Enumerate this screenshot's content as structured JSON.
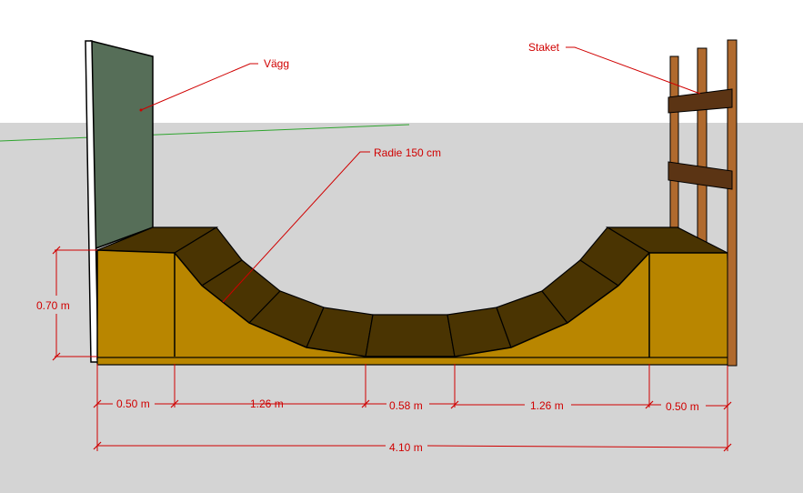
{
  "labels": {
    "wall": "Vägg",
    "fence": "Staket",
    "radius": "Radie 150 cm"
  },
  "dimensions": {
    "height": "0.70 m",
    "deck_left": "0.50 m",
    "transition_left": "1.26 m",
    "flat_bottom": "0.58 m",
    "transition_right": "1.26 m",
    "deck_right": "0.50 m",
    "total_length": "4.10 m"
  },
  "colors": {
    "sky": "#ffffff",
    "ground": "#d4d4d4",
    "wall_face": "#566e58",
    "wall_edge": "#ffffff",
    "ramp_front": "#b98600",
    "ramp_top": "#4a3402",
    "fence_post": "#b06a2e",
    "fence_rail": "#5b3414",
    "horizon": "#2fa52f",
    "annotation": "#d00000"
  }
}
